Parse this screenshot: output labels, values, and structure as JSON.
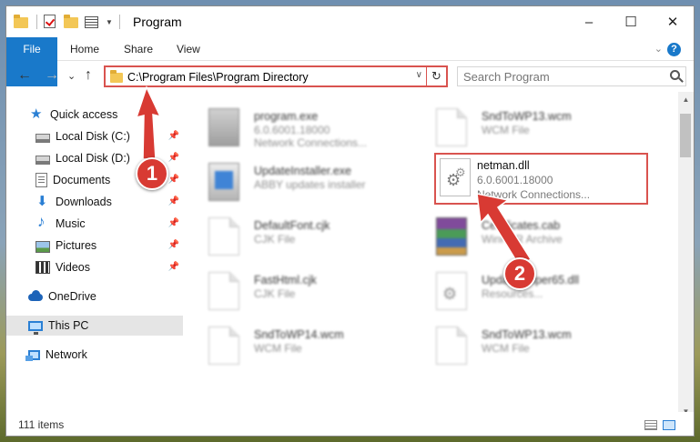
{
  "window": {
    "title": "Program",
    "controls": {
      "minimize": "–",
      "maximize": "☐",
      "close": "✕"
    }
  },
  "ribbon": {
    "tabs": [
      {
        "label": "File"
      },
      {
        "label": "Home"
      },
      {
        "label": "Share"
      },
      {
        "label": "View"
      }
    ],
    "collapse_glyph": "⌄",
    "help_glyph": "?"
  },
  "nav": {
    "back": "←",
    "forward": "→",
    "recent": "⌄",
    "up": "↑",
    "address": "C:\\Program Files\\Program Directory",
    "refresh": "↻",
    "search_placeholder": "Search Program"
  },
  "sidebar": {
    "items": [
      {
        "label": "Quick access"
      },
      {
        "label": "Local Disk (C:)"
      },
      {
        "label": "Local Disk (D:)"
      },
      {
        "label": "Documents"
      },
      {
        "label": "Downloads"
      },
      {
        "label": "Music"
      },
      {
        "label": "Pictures"
      },
      {
        "label": "Videos"
      },
      {
        "label": "OneDrive"
      },
      {
        "label": "This PC"
      },
      {
        "label": "Network"
      }
    ],
    "pin_glyph": "📌"
  },
  "files": [
    {
      "name": "program.exe",
      "line2": "6.0.6001.18000",
      "line3": "Network Connections..."
    },
    {
      "name": "SndToWP13.wcm",
      "line2": "WCM File"
    },
    {
      "name": "UpdateInstaller.exe",
      "line2": "ABBY updates installer"
    },
    {
      "name": "netman.dll",
      "line2": "6.0.6001.18000",
      "line3": "Network Connections..."
    },
    {
      "name": "DefaultFont.cjk",
      "line2": "CJK File"
    },
    {
      "name": "Certificates.cab",
      "line2": "WinRAR Archive"
    },
    {
      "name": "FastHtml.cjk",
      "line2": "CJK File"
    },
    {
      "name": "UpdateHelper65.dll",
      "line2": "Resources..."
    },
    {
      "name": "SndToWP14.wcm",
      "line2": "WCM File"
    },
    {
      "name": "SndToWP13.wcm",
      "line2": "WCM File"
    }
  ],
  "status": {
    "count": "111 items"
  },
  "callouts": {
    "one": "1",
    "two": "2"
  },
  "colors": {
    "accent": "#1979ca",
    "highlight": "#d9534f",
    "callout": "#d83a33"
  }
}
